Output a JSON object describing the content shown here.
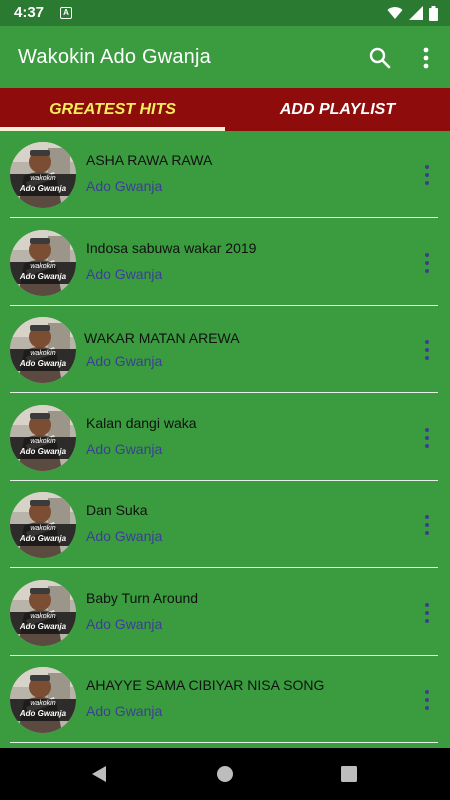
{
  "status_bar": {
    "time": "4:37",
    "notification_icon": "A"
  },
  "app_bar": {
    "title": "Wakokin Ado Gwanja",
    "search_icon": "search-icon",
    "menu_icon": "more-vert-icon"
  },
  "tabs": [
    {
      "label": "GREATEST HITS",
      "selected": true
    },
    {
      "label": "ADD PLAYLIST",
      "selected": false
    }
  ],
  "thumbnail": {
    "caption_top": "wakokin",
    "caption_bottom": "Ado Gwanja"
  },
  "songs": [
    {
      "title": "ASHA RAWA RAWA",
      "artist": "Ado Gwanja"
    },
    {
      "title": "Indosa sabuwa wakar 2019",
      "artist": "Ado Gwanja"
    },
    {
      "title": "WAKAR MATAN AREWA",
      "artist": "Ado Gwanja"
    },
    {
      "title": "Kalan dangi waka",
      "artist": "Ado Gwanja"
    },
    {
      "title": "Dan Suka",
      "artist": "Ado Gwanja"
    },
    {
      "title": "Baby Turn Around",
      "artist": "Ado Gwanja"
    },
    {
      "title": "AHAYYE SAMA CIBIYAR NISA SONG",
      "artist": "Ado Gwanja"
    }
  ],
  "colors": {
    "app_green": "#3a9c3f",
    "tab_red": "#8f0c0c",
    "selected_tab_yellow": "#f5ef5a",
    "artist_blue": "#3d3d9a"
  }
}
